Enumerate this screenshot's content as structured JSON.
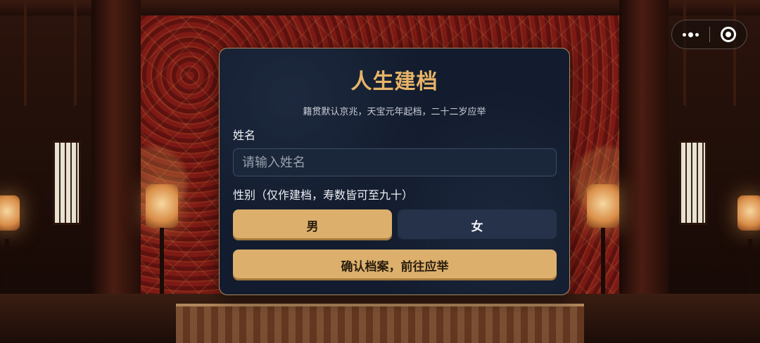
{
  "form": {
    "title": "人生建档",
    "subtitle": "籍贯默认京兆，天宝元年起档，二十二岁应举",
    "name_label": "姓名",
    "name_value": "",
    "name_placeholder": "请输入姓名",
    "gender_label": "性别（仅作建档，寿数皆可至九十）",
    "gender_options": [
      {
        "label": "男",
        "selected": true
      },
      {
        "label": "女",
        "selected": false
      }
    ],
    "confirm_label": "确认档案，前往应举"
  },
  "capsule": {
    "more_icon": "more-dots-icon",
    "close_icon": "target-circle-icon"
  },
  "colors": {
    "panel_bg": "#131c2e",
    "accent_gold": "#dcb06c",
    "title_gold": "#e7b468",
    "unselected_button": "#26324a"
  }
}
